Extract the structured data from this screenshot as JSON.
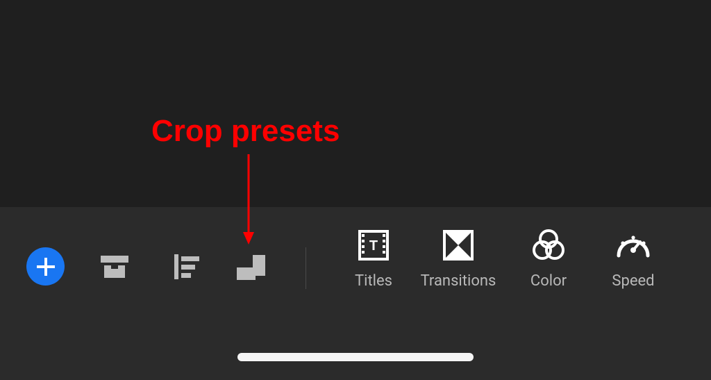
{
  "annotation": {
    "text": "Crop presets"
  },
  "toolbar": {
    "items": [
      {
        "name": "add",
        "label": ""
      },
      {
        "name": "project-archive",
        "label": ""
      },
      {
        "name": "track-controls",
        "label": ""
      },
      {
        "name": "crop-presets",
        "label": ""
      }
    ],
    "labeled_items": [
      {
        "name": "titles",
        "label": "Titles"
      },
      {
        "name": "transitions",
        "label": "Transitions"
      },
      {
        "name": "color",
        "label": "Color"
      },
      {
        "name": "speed",
        "label": "Speed"
      }
    ]
  },
  "colors": {
    "canvas_bg": "#1f1f1f",
    "panel_bg": "#2b2b2b",
    "accent": "#1976f2",
    "icon": "#bdbdbd",
    "label": "#b8b8b8",
    "annotation": "#ff0000"
  }
}
